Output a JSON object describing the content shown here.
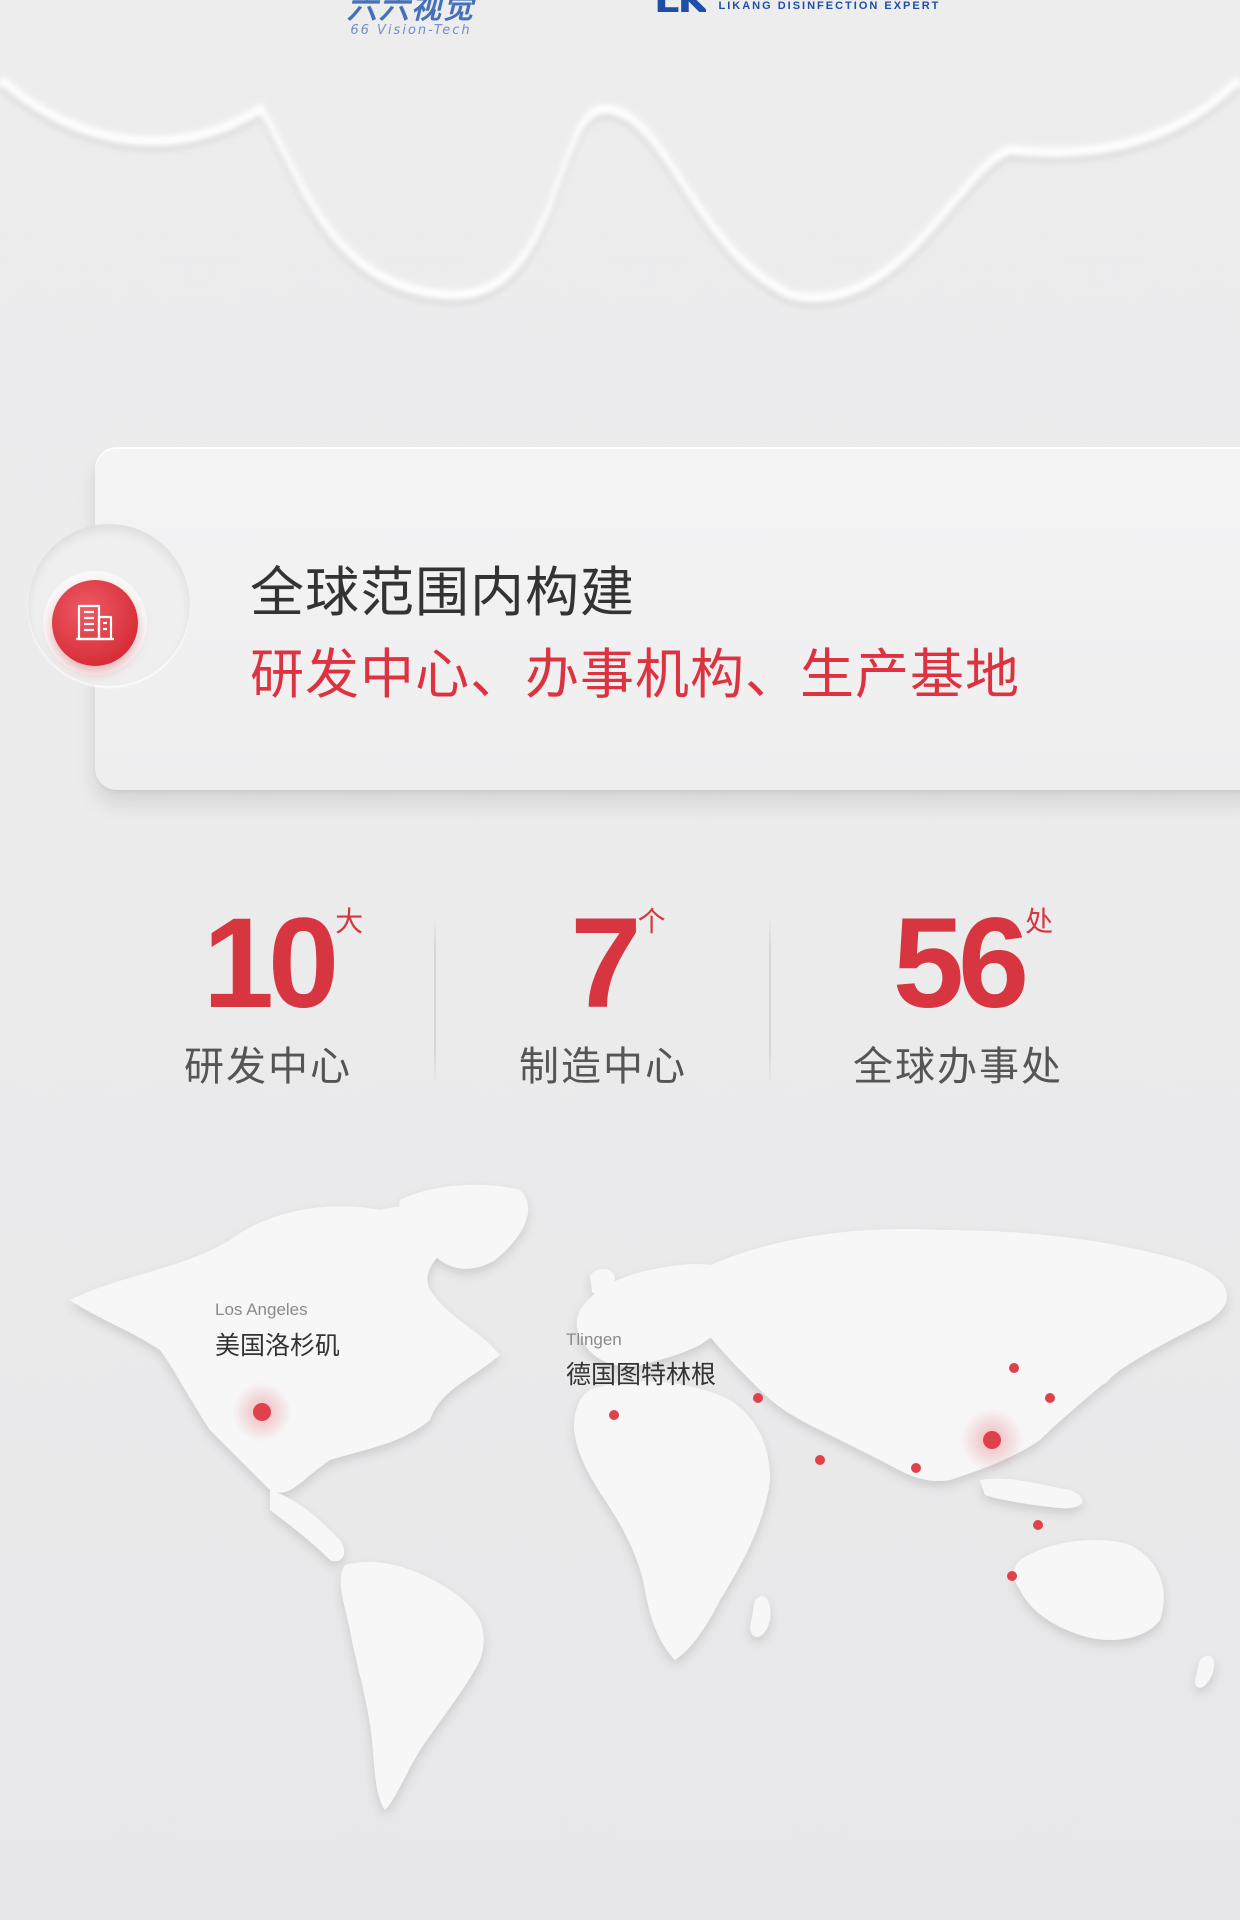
{
  "logos": {
    "brand_66_zh": "六六视觉",
    "brand_66_en": "66 Vision-Tech",
    "brand_lk_mark": "LK",
    "brand_lk_tagline": "LIKANG DISINFECTION EXPERT"
  },
  "feature": {
    "icon": "building-icon",
    "line1": "全球范围内构建",
    "line2": "研发中心、办事机构、生产基地",
    "accent_color": "#dd3340"
  },
  "stats": [
    {
      "value": "10",
      "unit": "大",
      "label": "研发中心"
    },
    {
      "value": "7",
      "unit": "个",
      "label": "制造中心"
    },
    {
      "value": "56",
      "unit": "处",
      "label": "全球办事处"
    }
  ],
  "map": {
    "locations": [
      {
        "name_en": "Los Angeles",
        "name_zh": "美国洛杉矶"
      },
      {
        "name_en": "Tlingen",
        "name_zh": "德国图特林根"
      }
    ]
  }
}
